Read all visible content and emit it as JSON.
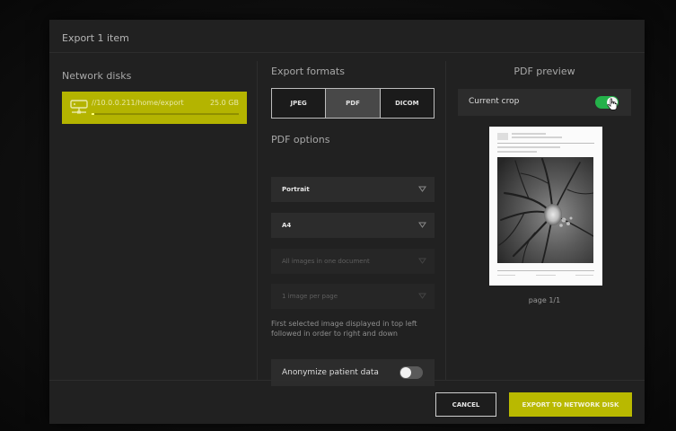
{
  "dialog": {
    "title": "Export 1 item"
  },
  "network_disks": {
    "heading": "Network disks",
    "items": [
      {
        "path": "//10.0.0.211/home/export",
        "size": "25.0 GB",
        "usage_fraction": 0.02,
        "icon": "network-drive-icon"
      }
    ]
  },
  "export_formats": {
    "heading": "Export formats",
    "options": [
      {
        "label": "JPEG",
        "selected": false
      },
      {
        "label": "PDF",
        "selected": true
      },
      {
        "label": "DICOM",
        "selected": false
      }
    ]
  },
  "pdf_options": {
    "heading": "PDF options",
    "orientation": "Portrait",
    "paper_size": "A4",
    "grouping": "All images in one document",
    "layout": "1 image per page",
    "note": "First selected image displayed in top left followed in order to right and down",
    "anonymize_label": "Anonymize patient data",
    "anonymize_on": false
  },
  "preview": {
    "heading": "PDF preview",
    "current_crop_label": "Current crop",
    "current_crop_on": true,
    "page_label": "page 1/1"
  },
  "footer": {
    "cancel_label": "CANCEL",
    "export_label": "EXPORT TO NETWORK DISK"
  },
  "colors": {
    "accent": "#b9b900",
    "toggle_on": "#24b14a",
    "dialog_bg": "#212121"
  }
}
